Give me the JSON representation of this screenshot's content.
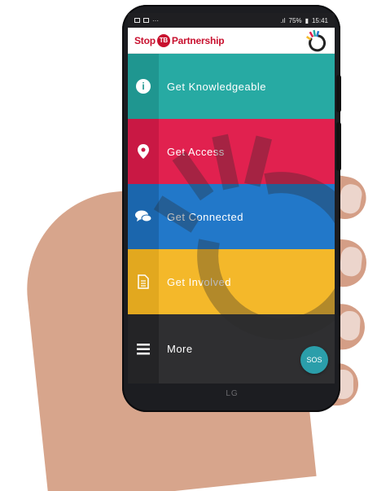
{
  "status_bar": {
    "network": ".ıl",
    "battery": "75%",
    "time": "15:41"
  },
  "header": {
    "logo_prefix": "Stop",
    "logo_tb": "TB",
    "logo_suffix": "Partnership"
  },
  "menu": {
    "items": [
      {
        "label": "Get Knowledgeable",
        "icon": "info-icon"
      },
      {
        "label": "Get Access",
        "icon": "location-pin-icon"
      },
      {
        "label": "Get Connected",
        "icon": "chat-bubbles-icon"
      },
      {
        "label": "Get Involved",
        "icon": "document-icon"
      },
      {
        "label": "More",
        "icon": "hamburger-menu-icon"
      }
    ]
  },
  "sos_label": "SOS",
  "phone_brand": "LG",
  "colors": {
    "teal": "#27aaa3",
    "red": "#e1214f",
    "blue": "#2278c9",
    "yellow": "#f4b82a",
    "dark": "#2f2f31",
    "logo_red": "#c8102e"
  }
}
